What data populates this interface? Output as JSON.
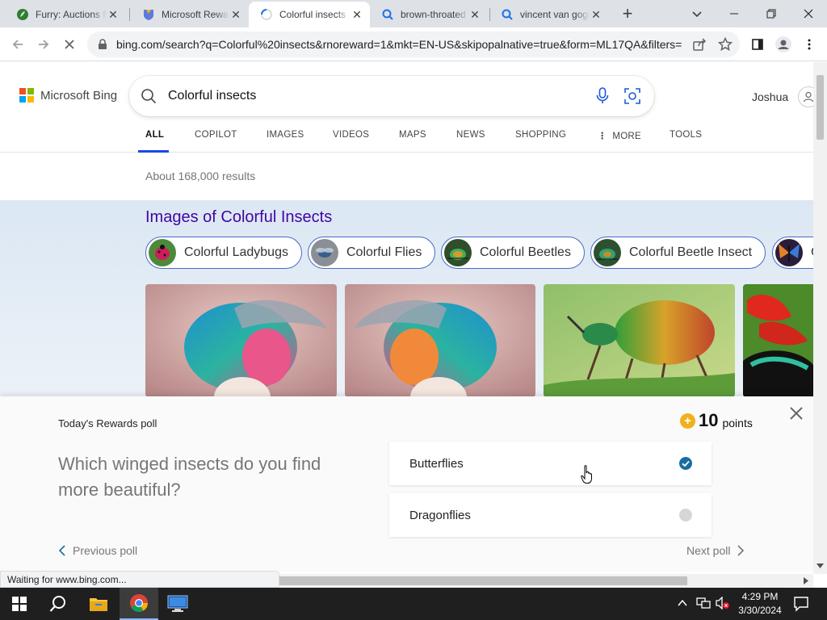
{
  "browser": {
    "tabs": [
      {
        "title": "Furry: Auctions for",
        "icon": "furry-favicon",
        "active": false
      },
      {
        "title": "Microsoft Rewards",
        "icon": "rewards-favicon",
        "active": false
      },
      {
        "title": "Colorful insects - Search",
        "icon": "loading-spinner",
        "active": true
      },
      {
        "title": "brown-throated sloth",
        "icon": "search-favicon",
        "active": false
      },
      {
        "title": "vincent van gogh",
        "icon": "search-favicon",
        "active": false
      }
    ],
    "url": "bing.com/search?q=Colorful%20insects&rnoreward=1&mkt=EN-US&skipopalnative=true&form=ML17QA&filters=",
    "status": "Waiting for www.bing.com..."
  },
  "bing": {
    "logo_text": "Microsoft Bing",
    "query": "Colorful insects",
    "user_name": "Joshua",
    "nav": [
      "ALL",
      "COPILOT",
      "IMAGES",
      "VIDEOS",
      "MAPS",
      "NEWS",
      "SHOPPING",
      "MORE",
      "TOOLS"
    ],
    "results_count": "About 168,000 results",
    "images_heading": "Images of Colorful Insects",
    "chips": [
      "Colorful Ladybugs",
      "Colorful Flies",
      "Colorful Beetles",
      "Colorful Beetle Insect",
      "C"
    ]
  },
  "poll": {
    "label": "Today's Rewards poll",
    "points": "10",
    "points_word": "points",
    "question": "Which winged insects do you find more beautiful?",
    "options": [
      {
        "label": "Butterflies",
        "selected": true
      },
      {
        "label": "Dragonflies",
        "selected": false
      }
    ],
    "prev": "Previous poll",
    "next": "Next poll"
  },
  "taskbar": {
    "time": "4:29 PM",
    "date": "3/30/2024"
  },
  "colors": {
    "bing_link_purple": "#4007a2",
    "bing_accent_blue": "#174ae4",
    "poll_check_blue": "#1a6e9f",
    "coin_gold": "#f2b01e"
  }
}
